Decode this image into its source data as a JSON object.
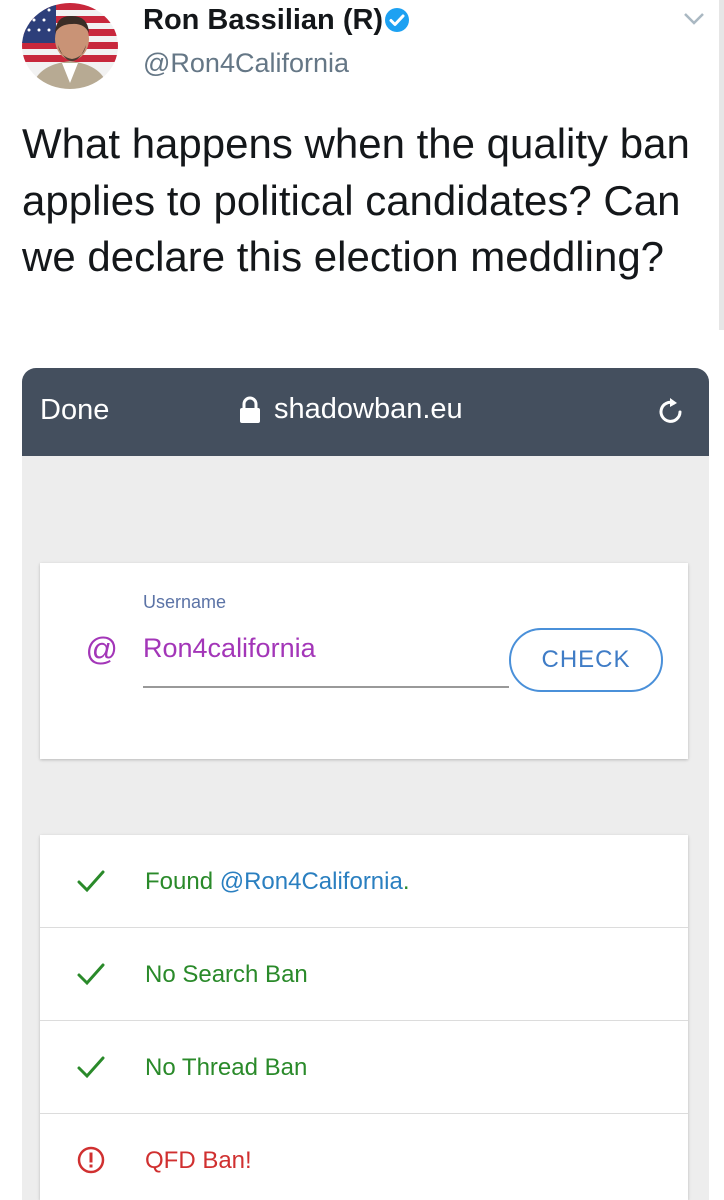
{
  "tweet": {
    "display_name": "Ron Bassilian (R)",
    "handle": "@Ron4California",
    "text": "What happens when the quality ban applies to political candidates? Can we declare this election meddling?"
  },
  "browser": {
    "done_label": "Done",
    "url": "shadowban.eu"
  },
  "form": {
    "field_label": "Username",
    "at_symbol": "@",
    "username_value": "Ron4california",
    "check_label": "CHECK"
  },
  "results": [
    {
      "icon": "check-icon",
      "prefix": "Found ",
      "mention": "@Ron4California",
      "suffix": ".",
      "status": "ok"
    },
    {
      "icon": "check-icon",
      "prefix": "No Search Ban",
      "mention": "",
      "suffix": "",
      "status": "ok"
    },
    {
      "icon": "check-icon",
      "prefix": "No Thread Ban",
      "mention": "",
      "suffix": "",
      "status": "ok"
    },
    {
      "icon": "alert-icon",
      "prefix": "QFD Ban!",
      "mention": "",
      "suffix": "",
      "status": "ban"
    }
  ],
  "colors": {
    "browser_bar": "#444f5e",
    "ok_green": "#2a8a2a",
    "ban_red": "#d03030",
    "link_blue": "#2a7fc0",
    "accent_purple": "#a336b8"
  }
}
